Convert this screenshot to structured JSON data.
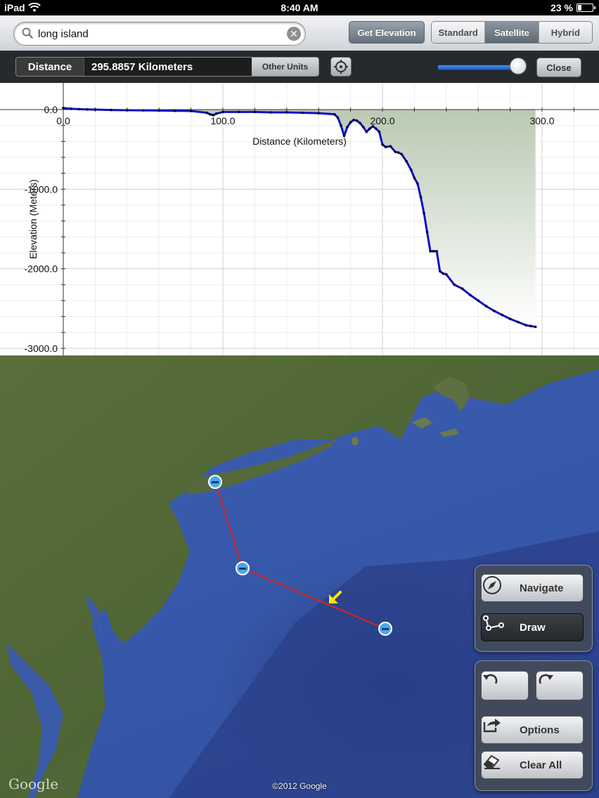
{
  "status_bar": {
    "device": "iPad",
    "time": "8:40 AM",
    "battery": "23 %",
    "battery_level": 0.23
  },
  "toolbar": {
    "search_value": "long island",
    "get_elevation": "Get Elevation",
    "map_types": [
      "Standard",
      "Satellite",
      "Hybrid"
    ],
    "active_map_type": "Satellite"
  },
  "distance_bar": {
    "label": "Distance",
    "value": "295.8857 Kilometers",
    "other_units": "Other Units",
    "close": "Close",
    "slider_level": 0.95
  },
  "chart_data": {
    "type": "area",
    "xlabel": "Distance (Kilometers)",
    "ylabel": "Elevation (Meters)",
    "xlim": [
      0,
      324
    ],
    "ylim": [
      -3000,
      30
    ],
    "x_ticks": [
      0,
      100,
      200,
      300
    ],
    "x_tick_labels": [
      "0.0",
      "100.0",
      "200.0",
      "300.0"
    ],
    "y_ticks": [
      0,
      -1000,
      -2000,
      -3000
    ],
    "y_tick_labels": [
      "0.0",
      "-1000.0",
      "-2000.0",
      "-3000.0"
    ],
    "grid": true,
    "series": [
      {
        "x": [
          0,
          5,
          10,
          15,
          20,
          30,
          40,
          50,
          60,
          70,
          80,
          90,
          92,
          94,
          96,
          100,
          110,
          120,
          130,
          140,
          150,
          160,
          170,
          172,
          174,
          176,
          178,
          180,
          182,
          184,
          186,
          188,
          190,
          192,
          194,
          196,
          198,
          200,
          202,
          205,
          208,
          210,
          212,
          215,
          218,
          220,
          222,
          224,
          226,
          228,
          230,
          232,
          234,
          236,
          238,
          240,
          245,
          250,
          255,
          260,
          265,
          270,
          275,
          280,
          285,
          290,
          293,
          295.9
        ],
        "values": [
          20,
          10,
          5,
          2,
          0,
          -5,
          -8,
          -10,
          -12,
          -15,
          -18,
          -40,
          -60,
          -70,
          -50,
          -30,
          -30,
          -30,
          -35,
          -35,
          -40,
          -45,
          -60,
          -100,
          -200,
          -330,
          -220,
          -160,
          -130,
          -140,
          -170,
          -220,
          -280,
          -240,
          -210,
          -240,
          -280,
          -440,
          -470,
          -460,
          -530,
          -540,
          -560,
          -650,
          -760,
          -860,
          -930,
          -1100,
          -1300,
          -1540,
          -1780,
          -1780,
          -1780,
          -2030,
          -2060,
          -2070,
          -2200,
          -2250,
          -2330,
          -2400,
          -2470,
          -2530,
          -2580,
          -2630,
          -2670,
          -2710,
          -2720,
          -2730
        ]
      }
    ]
  },
  "map": {
    "copyright": "©2012 Google",
    "watermark": "Google"
  },
  "side_panel": {
    "navigate": "Navigate",
    "draw": "Draw",
    "active_mode": "Draw",
    "options": "Options",
    "clear_all": "Clear All"
  },
  "icons": {
    "search": "search-icon",
    "clear": "clear-icon",
    "target": "locate-icon",
    "compass": "compass-icon",
    "draw": "path-icon",
    "undo": "undo-icon",
    "redo": "redo-icon",
    "options": "share-arrow-icon",
    "eraser": "eraser-icon"
  }
}
